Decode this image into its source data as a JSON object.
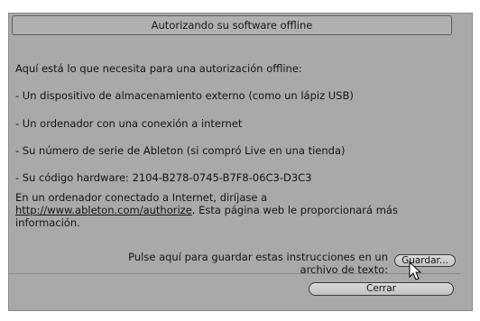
{
  "dialog": {
    "title": "Autorizando su software offline",
    "intro": "Aquí está lo que necesita para una autorización offline:",
    "items": [
      "- Un dispositivo de almacenamiento externo (como un lápiz USB)",
      "- Un ordenador con una conexión a internet",
      "- Su número de serie de Ableton (si compró Live en una tienda)",
      "- Su código hardware: 2104-B278-0745-B7F8-06C3-D3C3"
    ],
    "para_before_link": "En un ordenador conectado a Internet, diríjase a",
    "link": "http://www.ableton.com/authorize",
    "para_after_link": ". Esta página web le proporcionará más información.",
    "save_text": "Pulse aquí para guardar estas instrucciones en un archivo de texto:",
    "save_button": "Guardar...",
    "close_button": "Cerrar"
  },
  "icons": {
    "cursor": "mouse-pointer-icon"
  }
}
